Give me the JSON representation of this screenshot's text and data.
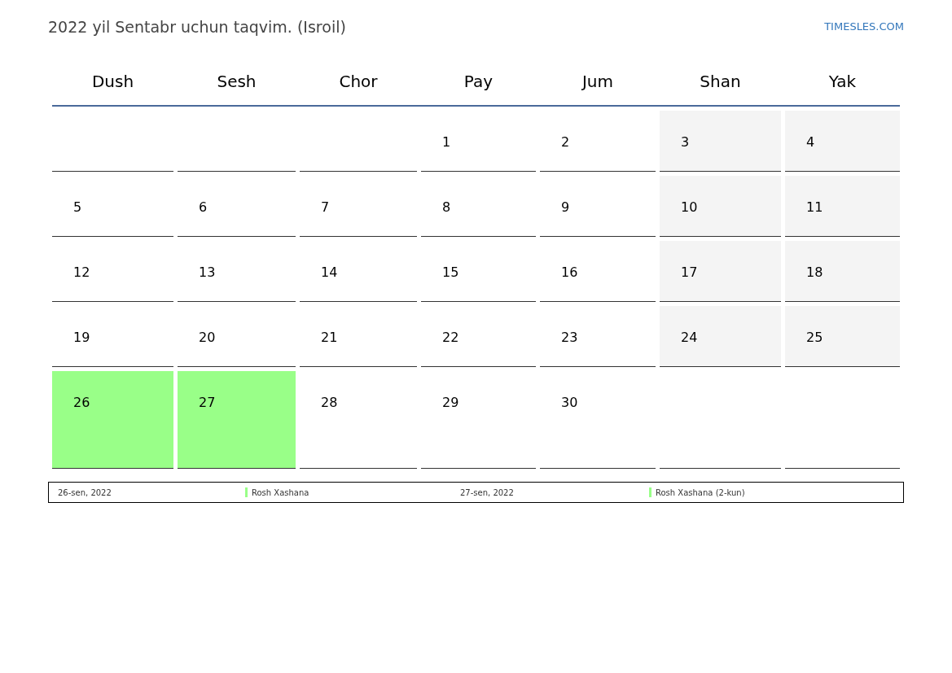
{
  "title": "2022 yil Sentabr uchun taqvim. (Isroil)",
  "site_link": "TIMESLES.COM",
  "weekdays": [
    "Dush",
    "Sesh",
    "Chor",
    "Pay",
    "Jum",
    "Shan",
    "Yak"
  ],
  "weeks": [
    [
      {
        "kind": "blank"
      },
      {
        "kind": "blank"
      },
      {
        "kind": "blank"
      },
      {
        "kind": "weekday",
        "day": "1"
      },
      {
        "kind": "weekday",
        "day": "2"
      },
      {
        "kind": "weekend",
        "day": "3"
      },
      {
        "kind": "weekend",
        "day": "4"
      }
    ],
    [
      {
        "kind": "weekday",
        "day": "5"
      },
      {
        "kind": "weekday",
        "day": "6"
      },
      {
        "kind": "weekday",
        "day": "7"
      },
      {
        "kind": "weekday",
        "day": "8"
      },
      {
        "kind": "weekday",
        "day": "9"
      },
      {
        "kind": "weekend",
        "day": "10"
      },
      {
        "kind": "weekend",
        "day": "11"
      }
    ],
    [
      {
        "kind": "weekday",
        "day": "12"
      },
      {
        "kind": "weekday",
        "day": "13"
      },
      {
        "kind": "weekday",
        "day": "14"
      },
      {
        "kind": "weekday",
        "day": "15"
      },
      {
        "kind": "weekday",
        "day": "16"
      },
      {
        "kind": "weekend",
        "day": "17"
      },
      {
        "kind": "weekend",
        "day": "18"
      }
    ],
    [
      {
        "kind": "weekday",
        "day": "19"
      },
      {
        "kind": "weekday",
        "day": "20"
      },
      {
        "kind": "weekday",
        "day": "21"
      },
      {
        "kind": "weekday",
        "day": "22"
      },
      {
        "kind": "weekday",
        "day": "23"
      },
      {
        "kind": "weekend",
        "day": "24"
      },
      {
        "kind": "weekend",
        "day": "25"
      }
    ],
    [
      {
        "kind": "holiday",
        "day": "26"
      },
      {
        "kind": "holiday",
        "day": "27"
      },
      {
        "kind": "weekday",
        "day": "28"
      },
      {
        "kind": "weekday",
        "day": "29"
      },
      {
        "kind": "weekday",
        "day": "30"
      },
      {
        "kind": "blank"
      },
      {
        "kind": "blank"
      }
    ]
  ],
  "legend": [
    {
      "date": "26-sen, 2022",
      "name": "Rosh Xashana",
      "color": "#99ff88"
    },
    {
      "date": "27-sen, 2022",
      "name": "Rosh Xashana (2-kun)",
      "color": "#99ff88"
    }
  ]
}
